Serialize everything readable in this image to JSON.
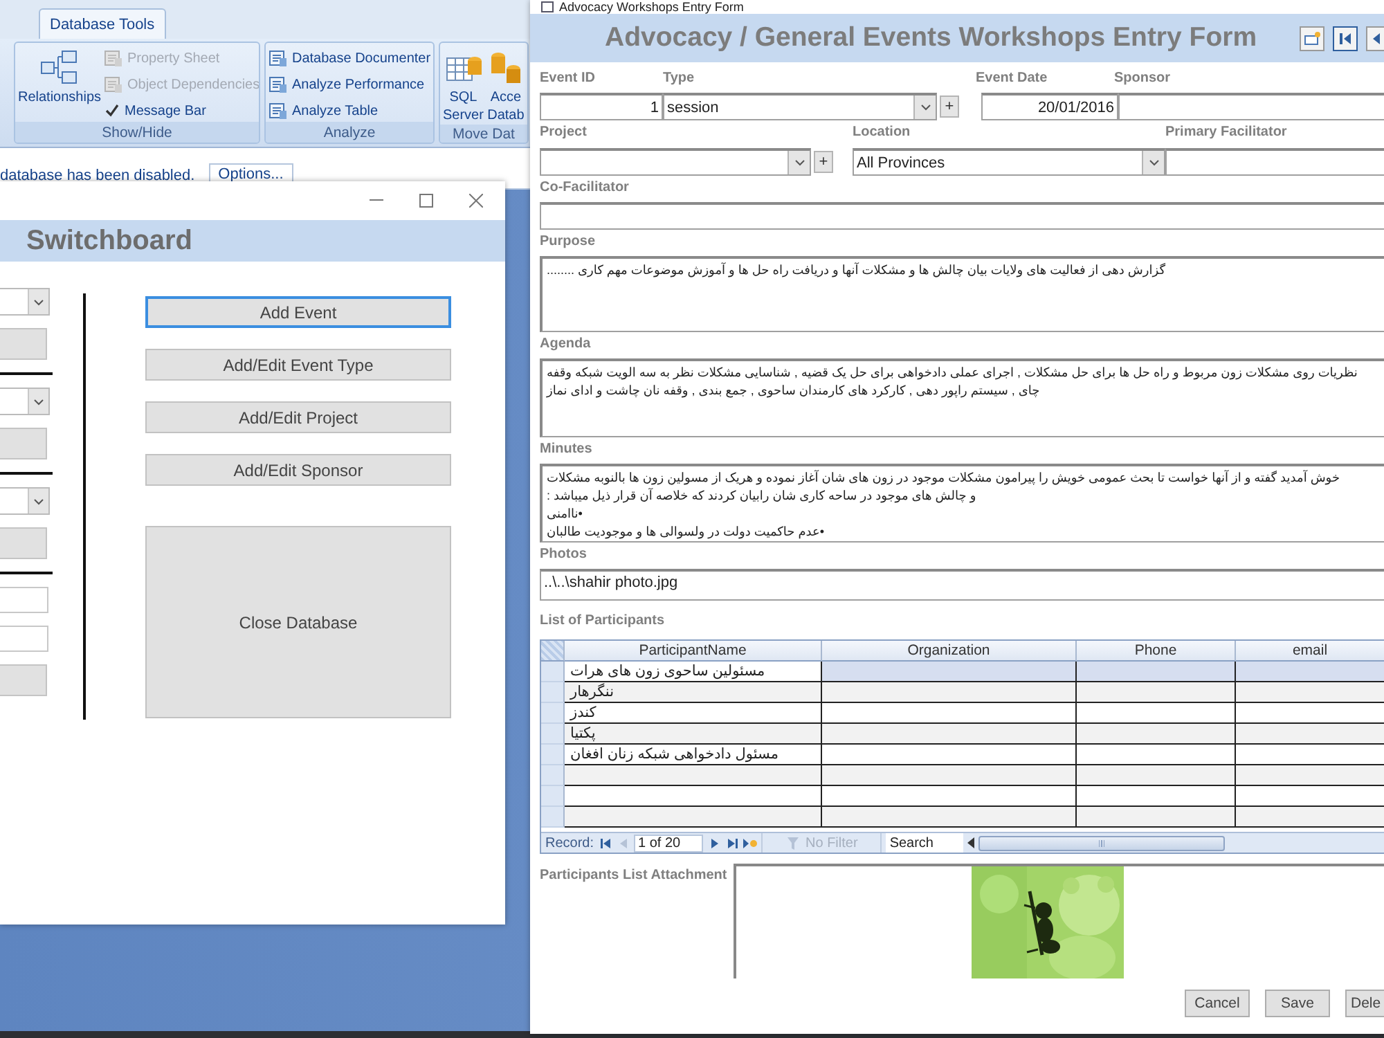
{
  "ribbon": {
    "tabs": [
      {
        "label": "Database Tools",
        "selected": true
      }
    ],
    "groups": [
      {
        "label": "Show/Hide",
        "items": [
          {
            "kind": "large",
            "label": "Relationships"
          },
          {
            "kind": "small",
            "label": "Property Sheet",
            "disabled": true
          },
          {
            "kind": "small",
            "label": "Object Dependencies",
            "disabled": true
          },
          {
            "kind": "check",
            "label": "Message Bar",
            "checked": true
          }
        ]
      },
      {
        "label": "Analyze",
        "items": [
          {
            "kind": "small",
            "label": "Database Documenter",
            "disabled": false
          },
          {
            "kind": "small",
            "label": "Analyze Performance",
            "disabled": false
          },
          {
            "kind": "small",
            "label": "Analyze Table",
            "disabled": false
          }
        ]
      },
      {
        "label": "Move Dat",
        "items": [
          {
            "kind": "large",
            "label": "SQL Server"
          },
          {
            "kind": "large",
            "label": "Acce Datab"
          }
        ]
      }
    ]
  },
  "message_bar": {
    "text": "database has been disabled.",
    "button": "Options..."
  },
  "switchboard": {
    "title": "Switchboard",
    "left_controls": [
      {
        "kind": "combo"
      },
      {
        "kind": "button"
      },
      {
        "kind": "rule"
      },
      {
        "kind": "combo"
      },
      {
        "kind": "button"
      },
      {
        "kind": "rule"
      },
      {
        "kind": "combo"
      },
      {
        "kind": "button"
      },
      {
        "kind": "rule"
      },
      {
        "kind": "input"
      },
      {
        "kind": "input"
      },
      {
        "kind": "button"
      }
    ],
    "buttons": [
      {
        "label": "Add Event",
        "focused": true,
        "kind": "normal"
      },
      {
        "label": "Add/Edit Event Type",
        "focused": false,
        "kind": "normal"
      },
      {
        "label": "Add/Edit Project",
        "focused": false,
        "kind": "normal"
      },
      {
        "label": "Add/Edit Sponsor",
        "focused": false,
        "kind": "normal"
      },
      {
        "label": "Close Database",
        "focused": false,
        "kind": "large"
      }
    ]
  },
  "form": {
    "window_title": "Advocacy Workshops Entry Form",
    "title": "Advocacy / General Events Workshops Entry Form",
    "event_id": {
      "label": "Event ID",
      "value": "1"
    },
    "type": {
      "label": "Type",
      "value": "session",
      "add_button": "+"
    },
    "event_date": {
      "label": "Event Date",
      "value": "20/01/2016"
    },
    "sponsor": {
      "label": "Sponsor"
    },
    "project": {
      "label": "Project",
      "add_button": "+"
    },
    "location": {
      "label": "Location",
      "value": "All Provinces"
    },
    "primary_facilitator": {
      "label": "Primary Facilitator"
    },
    "co_facilitator": {
      "label": "Co-Facilitator"
    },
    "purpose": {
      "label": "Purpose",
      "lines": [
        "گزارش دهی از فعالیت های ولایات بیان چالش ها و مشکلات آنها و دریافت راه حل ها و آموزش موضوعات مهم کاری ........"
      ]
    },
    "agenda": {
      "label": "Agenda",
      "lines": [
        "نظریات روی مشکلات زون مربوط  و راه حل ها برای حل مشکلات , اجرای عملی دادخواهی برای حل یک قضیه  , شناسایی مشکلات نظر به  سه الویت شبکه  وقفه",
        "چای , سیستم راپور دهی , کارکرد های کارمندان ساحوی , جمع بندی , وقفه نان چاشت  و ادای نماز"
      ]
    },
    "minutes": {
      "label": "Minutes",
      "lines": [
        "خوش آمدید گفته و از آنها خواست تا بحث عمومی خویش را پیرامون مشکلات موجود در زون های شان آغاز نموده و هریک از مسولین زون ها بالنوبه مشکلات",
        "و چالش های موجود در ساحه کاری شان رابیان کردند که خلاصه آن قرار ذیل میباشد :",
        "•ناامنی",
        "•عدم حاکمیت دولت در ولسوالی ها و موجودیت طالبان"
      ]
    },
    "photos": {
      "label": "Photos",
      "value": "..\\..\\shahir photo.jpg"
    },
    "participants": {
      "label": "List of Participants",
      "columns": [
        "ParticipantName",
        "Organization",
        "Phone",
        "email"
      ],
      "rows": [
        {
          "name": "مسئولین ساحوی زون های هرات",
          "selected": true
        },
        {
          "name": "ننگرهار",
          "selected": false
        },
        {
          "name": "کندز",
          "selected": false
        },
        {
          "name": "پکتیا",
          "selected": false
        },
        {
          "name": "مسئول دادخواهی شبکه زنان افغان",
          "selected": false
        }
      ],
      "navigator": {
        "label": "Record:",
        "position": "1 of 20",
        "filter": "No Filter",
        "search_placeholder": "Search"
      }
    },
    "attachment": {
      "label": "Participants List Attachment",
      "kind": "picture"
    },
    "buttons": [
      "Cancel",
      "Save",
      "Dele"
    ]
  }
}
